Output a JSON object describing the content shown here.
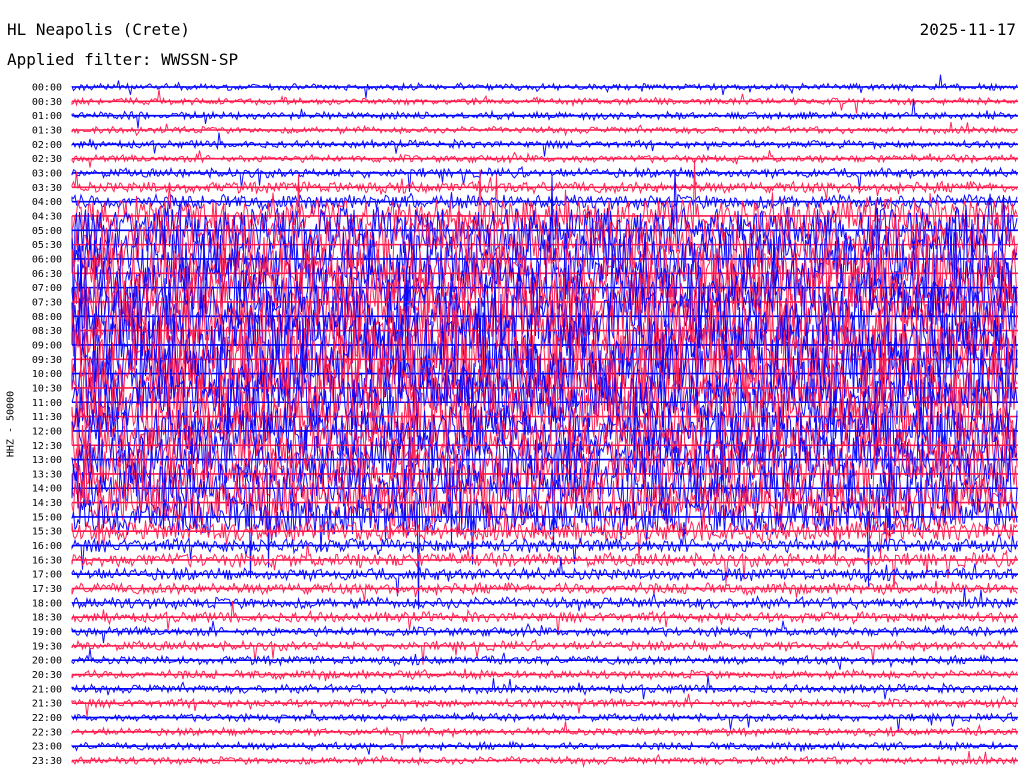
{
  "header": {
    "station": "HL Neapolis (Crete)",
    "filter": "Applied filter: WWSSN-SP",
    "date": "2025-11-17"
  },
  "chart_data": {
    "type": "line",
    "ylabel": "HHZ - 50000",
    "time_labels": [
      "00:00",
      "00:30",
      "01:00",
      "01:30",
      "02:00",
      "02:30",
      "03:00",
      "03:30",
      "04:00",
      "04:30",
      "05:00",
      "05:30",
      "06:00",
      "06:30",
      "07:00",
      "07:30",
      "08:00",
      "08:30",
      "09:00",
      "09:30",
      "10:00",
      "10:30",
      "11:00",
      "11:30",
      "12:00",
      "12:30",
      "13:00",
      "13:30",
      "14:00",
      "14:30",
      "15:00",
      "15:30",
      "16:00",
      "16:30",
      "17:00",
      "17:30",
      "18:00",
      "18:30",
      "19:00",
      "19:30",
      "20:00",
      "20:30",
      "21:00",
      "21:30",
      "22:00",
      "22:30",
      "23:00",
      "23:30"
    ],
    "trace_colors": [
      "#0000ff",
      "#ff1a4d"
    ],
    "trace_amplitude": [
      0.3,
      0.3,
      0.35,
      0.3,
      0.35,
      0.35,
      0.45,
      0.55,
      0.7,
      1.8,
      2.5,
      2.8,
      3.0,
      3.0,
      3.0,
      3.2,
      3.4,
      3.6,
      3.6,
      3.6,
      3.5,
      3.3,
      3.1,
      3.0,
      2.8,
      2.6,
      2.6,
      2.7,
      2.8,
      2.6,
      2.0,
      1.0,
      0.7,
      0.7,
      0.6,
      0.55,
      0.55,
      0.5,
      0.45,
      0.45,
      0.4,
      0.4,
      0.4,
      0.4,
      0.35,
      0.35,
      0.35,
      0.35
    ]
  }
}
